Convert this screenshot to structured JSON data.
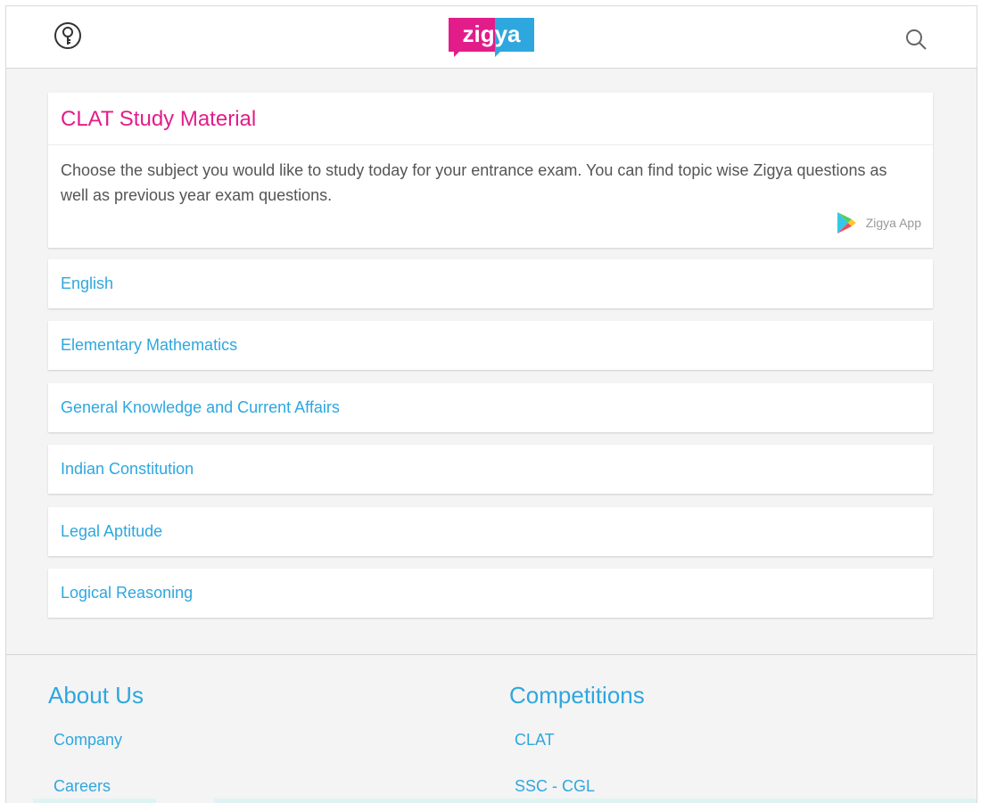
{
  "header": {
    "logo_text": "zigya",
    "user_icon": "user-key-icon",
    "search_icon": "search-icon"
  },
  "intro": {
    "title": "CLAT Study Material",
    "description": "Choose the subject you would like to study today for your entrance exam. You can find topic wise Zigya questions as well as previous year exam questions.",
    "app_label": "Zigya App",
    "app_icon": "google-play-icon"
  },
  "subjects": [
    {
      "label": "English"
    },
    {
      "label": "Elementary Mathematics"
    },
    {
      "label": "General Knowledge and Current Affairs"
    },
    {
      "label": "Indian Constitution"
    },
    {
      "label": "Legal Aptitude"
    },
    {
      "label": "Logical Reasoning"
    }
  ],
  "footer": {
    "about": {
      "heading": "About Us",
      "links": [
        "Company",
        "Careers"
      ]
    },
    "competitions": {
      "heading": "Competitions",
      "links": [
        "CLAT",
        "SSC - CGL"
      ]
    }
  },
  "colors": {
    "brand_pink": "#e21d8a",
    "brand_blue": "#2ea7df",
    "page_bg": "#f4f4f4",
    "card_bg": "#ffffff",
    "text_gray": "#555555"
  }
}
